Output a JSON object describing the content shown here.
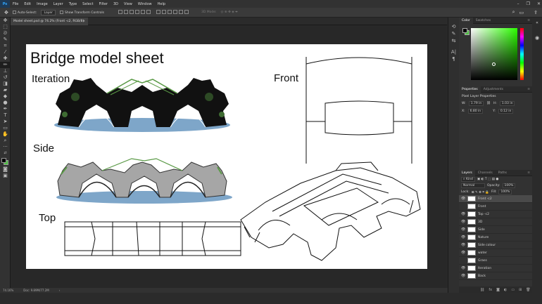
{
  "menu": [
    "File",
    "Edit",
    "Image",
    "Layer",
    "Type",
    "Select",
    "Filter",
    "3D",
    "View",
    "Window",
    "Help"
  ],
  "app_logo": "Ps",
  "options": {
    "auto_select": "Auto-Select:",
    "layer_select": "Layer",
    "show_transform": "Show Transform Controls",
    "mode_label": "3D Mode:"
  },
  "tab": {
    "title": "Model sheet.psd @ 74.2% (Front -c2, RGB/8)",
    "close": "×"
  },
  "document": {
    "title": "Bridge model sheet",
    "labels": {
      "iteration": "Iteration",
      "side": "Side",
      "top": "Top",
      "front": "Front"
    }
  },
  "status": {
    "zoom": "74.16%",
    "doc": "Doc: 9.89M/77.2M"
  },
  "color_panel": {
    "tabs": [
      "Color",
      "Swatches"
    ]
  },
  "properties_panel": {
    "tabs": [
      "Properties",
      "Adjustments"
    ],
    "heading": "Pixel Layer Properties",
    "w_label": "W:",
    "w_value": "1.79 in",
    "h_label": "H:",
    "h_value": "1.03 in",
    "x_label": "X:",
    "x_value": "6.80 in",
    "y_label": "Y:",
    "y_value": "0.12 in"
  },
  "layers_panel": {
    "tabs": [
      "Layers",
      "Channels",
      "Paths"
    ],
    "kind": "Kind",
    "blend": "Normal",
    "opacity_label": "Opacity:",
    "opacity_value": "100%",
    "lock_label": "Lock:",
    "fill_label": "Fill:",
    "fill_value": "100%",
    "layers": [
      {
        "name": "Front -c2"
      },
      {
        "name": "Front"
      },
      {
        "name": "Top -c2"
      },
      {
        "name": "3D"
      },
      {
        "name": "Side"
      },
      {
        "name": "Nature"
      },
      {
        "name": "Side colour"
      },
      {
        "name": "water"
      },
      {
        "name": "Grass"
      },
      {
        "name": "Iteration"
      },
      {
        "name": "Back"
      }
    ]
  },
  "colors": {
    "accent": "#31a8ff",
    "fg": "#000000",
    "bg": "#4bbf3e",
    "green": "#5b9a47",
    "water": "#7ea6c9"
  }
}
